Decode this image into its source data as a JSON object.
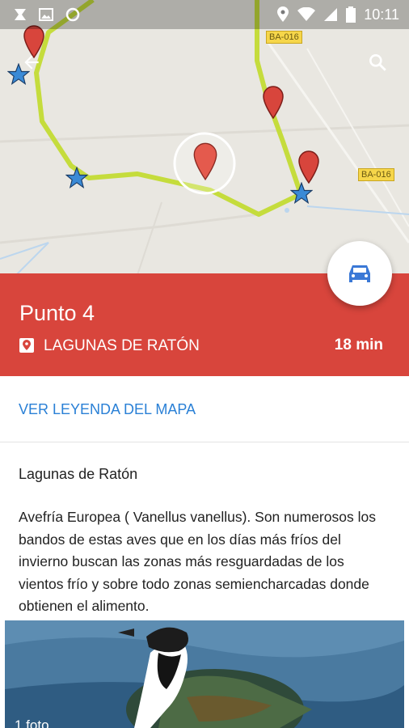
{
  "status_bar": {
    "time": "10:11",
    "left_icons": [
      "x-logo-icon",
      "image-icon",
      "sync-icon"
    ],
    "right_icons": [
      "location-icon",
      "wifi-icon",
      "signal-icon",
      "battery-icon"
    ]
  },
  "map": {
    "road_labels": [
      "BA-016",
      "BA-016"
    ],
    "route_color": "#c5dc3c",
    "marker_color": "#d8453c",
    "star_color": "#3a8ad6"
  },
  "toolbar": {
    "back_icon": "arrow-back-icon",
    "search_icon": "search-icon"
  },
  "fab": {
    "icon": "car-icon",
    "icon_color": "#3a78d6"
  },
  "header": {
    "title": "Punto 4",
    "place": "LAGUNAS DE RATÓN",
    "duration": "18 min",
    "background": "#d8453c"
  },
  "legend_link": "VER LEYENDA DEL MAPA",
  "section": {
    "title": "Lagunas de Ratón",
    "description": "Avefría Europea ( Vanellus vanellus). Son numerosos los bandos de estas aves que en los días más fríos del invierno buscan las zonas más resguardadas de los vientos frío y sobre todo zonas semiencharcadas donde obtienen el alimento."
  },
  "photo": {
    "count_label": "1 foto"
  }
}
